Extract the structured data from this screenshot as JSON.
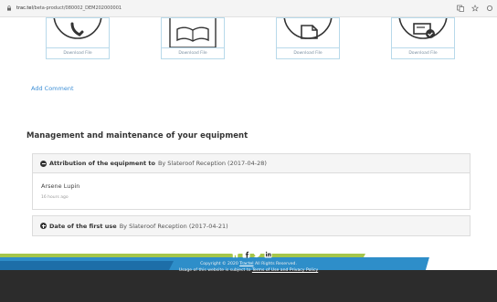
{
  "browser": {
    "url_host": "trac.tel",
    "url_path": "/beta-product/080002_DEM202000001"
  },
  "downloads": [
    {
      "label": "Download File",
      "icon": "phone-icon"
    },
    {
      "label": "Download File",
      "icon": "open-book-icon"
    },
    {
      "label": "Download File",
      "icon": "document-icon"
    },
    {
      "label": "Download File",
      "icon": "certificate-check-icon"
    }
  ],
  "comments": {
    "add_comment": "Add Comment"
  },
  "management": {
    "title": "Management and maintenance of your equipment",
    "entries": [
      {
        "label": "Attribution of the equipment to",
        "by": "By Slateroof Reception (2017-04-28)",
        "user": "Arsene Lupin",
        "time": "16 hours ago",
        "expanded": true
      },
      {
        "label": "Date of the first use",
        "by": "By Slateroof Reception (2017-04-21)",
        "expanded": false
      }
    ]
  },
  "footer": {
    "copyright_prefix": "Copyright © 2020",
    "copyright_link": "Tractel",
    "copyright_suffix": "All Rights Reserved.",
    "usage_prefix": "Usage of this website is subject to",
    "usage_link": "Terms of Use and Privacy Policy",
    "social": [
      "home-icon",
      "facebook-icon",
      "twitter-icon",
      "linkedin-icon"
    ]
  },
  "colors": {
    "accent_blue": "#3d8fd6",
    "footer_bg": "#2c2c2c",
    "stripe_green": "#a5c64a",
    "stripe_blue": "#2e8ec9",
    "card_border": "#b8d9ea"
  }
}
